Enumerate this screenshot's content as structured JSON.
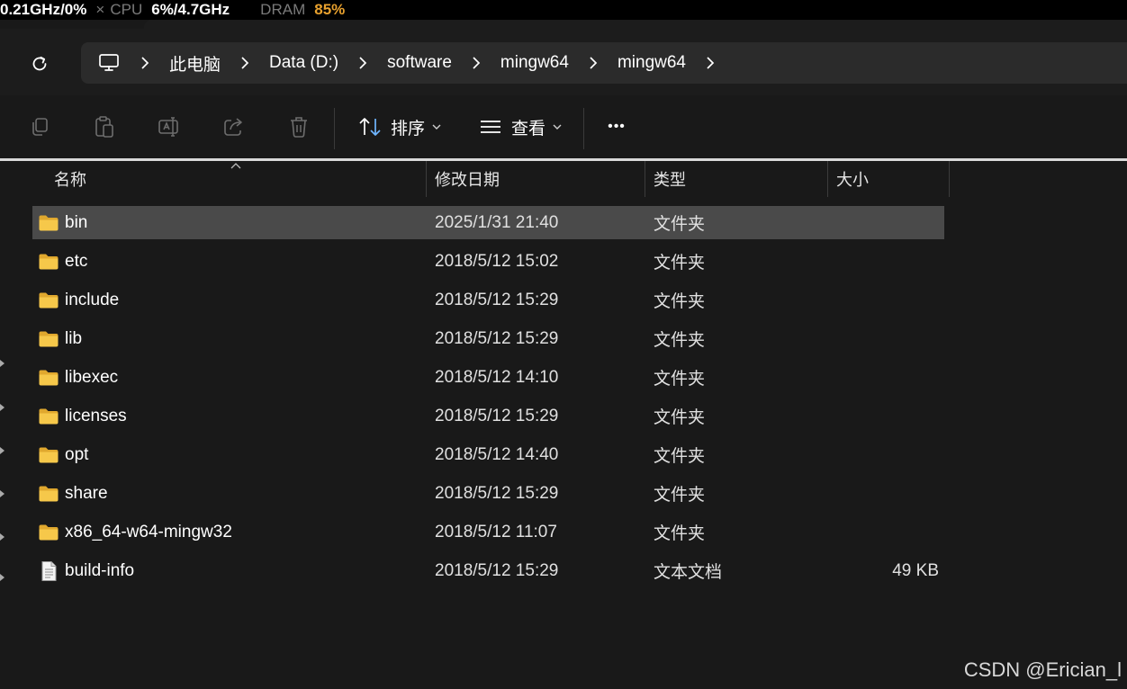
{
  "stats": {
    "gpu": "0.21GHz/0%",
    "sep_mark": "×",
    "cpu_label": "CPU",
    "cpu_value": "6%/4.7GHz",
    "dram_label": "DRAM",
    "dram_value": "85%"
  },
  "address": {
    "root_icon": "computer-icon",
    "crumbs": [
      "此电脑",
      "Data (D:)",
      "software",
      "mingw64",
      "mingw64"
    ]
  },
  "toolbar": {
    "icons": [
      "copy-icon",
      "paste-icon",
      "rename-icon",
      "share-icon",
      "delete-icon"
    ],
    "sort_label": "排序",
    "view_label": "查看",
    "more_label": "•••"
  },
  "columns": {
    "name": "名称",
    "date": "修改日期",
    "type": "类型",
    "size": "大小"
  },
  "files": [
    {
      "name": "bin",
      "date": "2025/1/31 21:40",
      "type": "文件夹",
      "size": "",
      "icon": "folder-icon",
      "selected": true
    },
    {
      "name": "etc",
      "date": "2018/5/12 15:02",
      "type": "文件夹",
      "size": "",
      "icon": "folder-icon"
    },
    {
      "name": "include",
      "date": "2018/5/12 15:29",
      "type": "文件夹",
      "size": "",
      "icon": "folder-icon"
    },
    {
      "name": "lib",
      "date": "2018/5/12 15:29",
      "type": "文件夹",
      "size": "",
      "icon": "folder-icon"
    },
    {
      "name": "libexec",
      "date": "2018/5/12 14:10",
      "type": "文件夹",
      "size": "",
      "icon": "folder-icon"
    },
    {
      "name": "licenses",
      "date": "2018/5/12 15:29",
      "type": "文件夹",
      "size": "",
      "icon": "folder-icon"
    },
    {
      "name": "opt",
      "date": "2018/5/12 14:40",
      "type": "文件夹",
      "size": "",
      "icon": "folder-icon"
    },
    {
      "name": "share",
      "date": "2018/5/12 15:29",
      "type": "文件夹",
      "size": "",
      "icon": "folder-icon"
    },
    {
      "name": "x86_64-w64-mingw32",
      "date": "2018/5/12 11:07",
      "type": "文件夹",
      "size": "",
      "icon": "folder-icon"
    },
    {
      "name": "build-info",
      "date": "2018/5/12 15:29",
      "type": "文本文档",
      "size": "49 KB",
      "icon": "text-file-icon"
    }
  ],
  "watermark": "CSDN @Erician_l",
  "colors": {
    "background": "#191919",
    "selected_row": "#4a4a4a",
    "folder": "#f2c14e",
    "warn": "#e8a12e"
  }
}
